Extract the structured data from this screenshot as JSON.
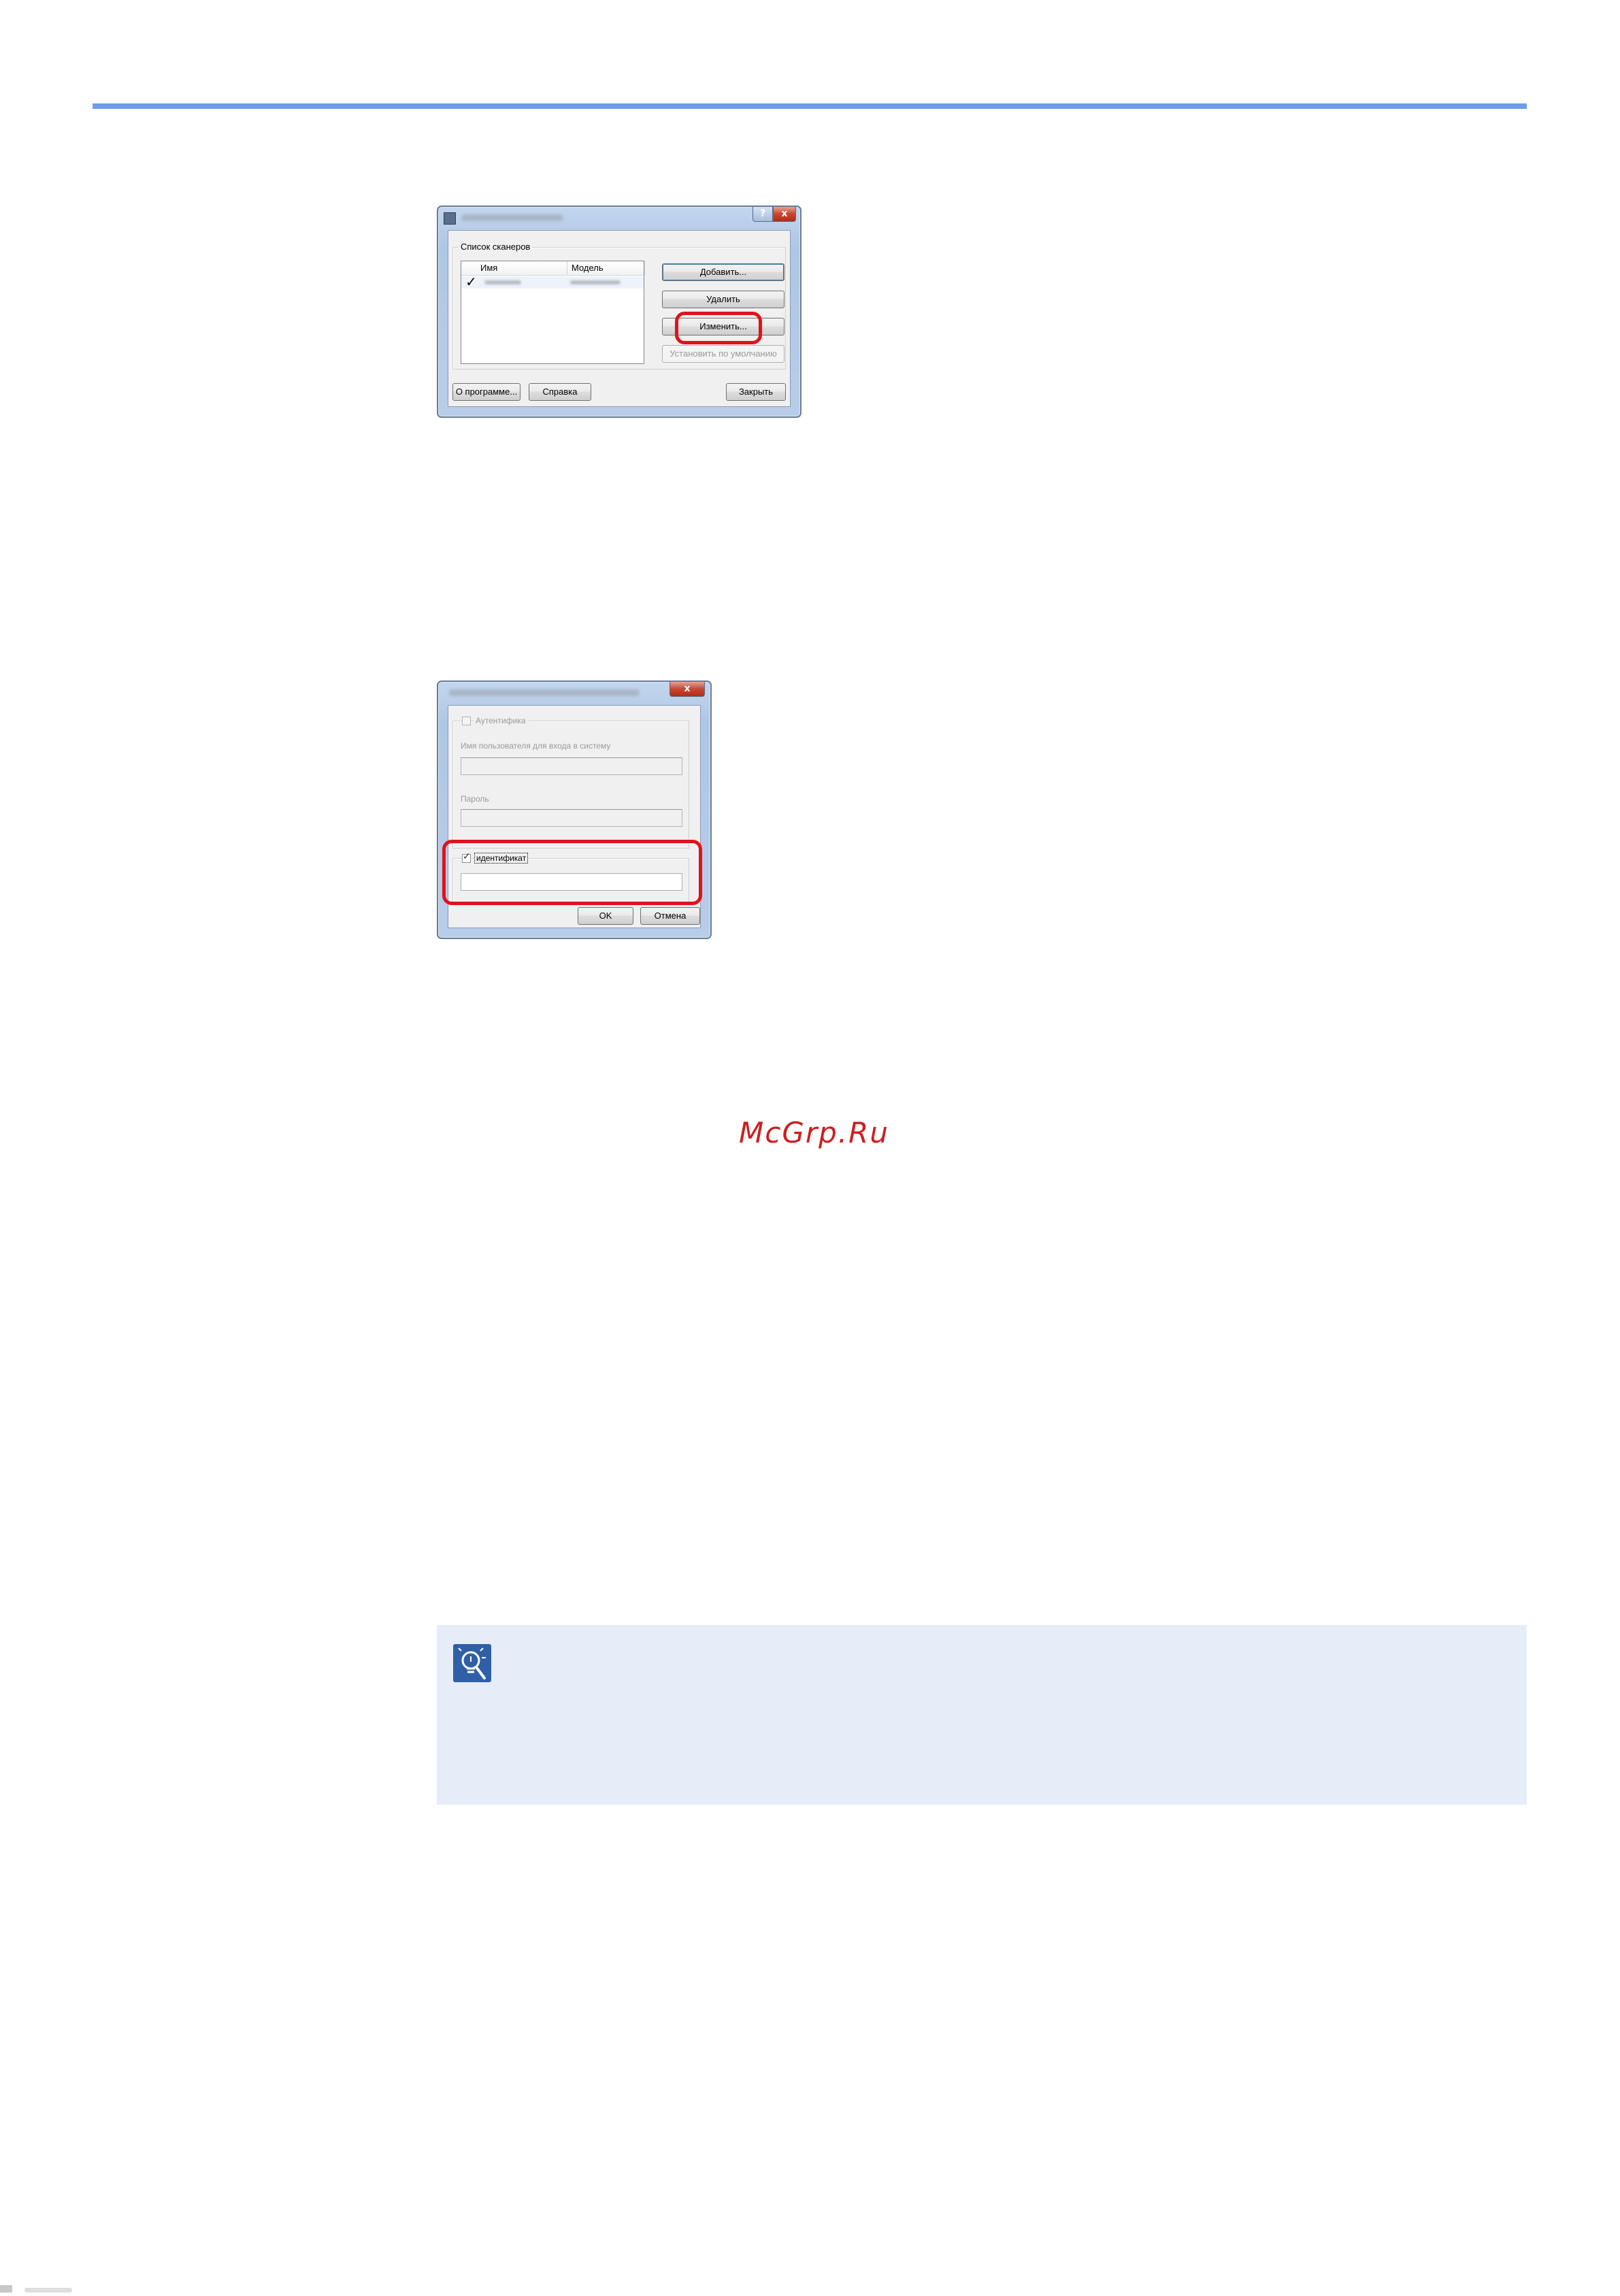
{
  "watermark": "McGrp.Ru",
  "dialog1": {
    "title": "",
    "help_glyph": "?",
    "close_glyph": "x",
    "group_label": "Список сканеров",
    "columns": [
      "Имя",
      "Модель"
    ],
    "rows": [
      {
        "checked": true,
        "name": "",
        "model": ""
      }
    ],
    "buttons": {
      "add": "Добавить...",
      "delete": "Удалить",
      "edit": "Изменить...",
      "set_default": "Установить по умолчанию",
      "about": "О программе...",
      "help": "Справка",
      "close": "Закрыть"
    },
    "highlight_color": "#e0121a"
  },
  "dialog2": {
    "title": "",
    "close_glyph": "x",
    "auth_label": "Аутентифика",
    "auth_checked": false,
    "username_label": "Имя пользователя для входа в систему",
    "username_value": "",
    "password_label": "Пароль",
    "password_value": "",
    "identifier_label": "идентификат",
    "identifier_checked": true,
    "identifier_value": "",
    "ok": "OK",
    "cancel": "Отмена",
    "highlight_color": "#e0121a"
  },
  "note": {
    "icon": "tip-lightbulb-icon",
    "text": ""
  },
  "colors": {
    "top_rule": "#6f9ce8",
    "note_bg": "#e6ecf8",
    "watermark": "#cc1f1f"
  }
}
